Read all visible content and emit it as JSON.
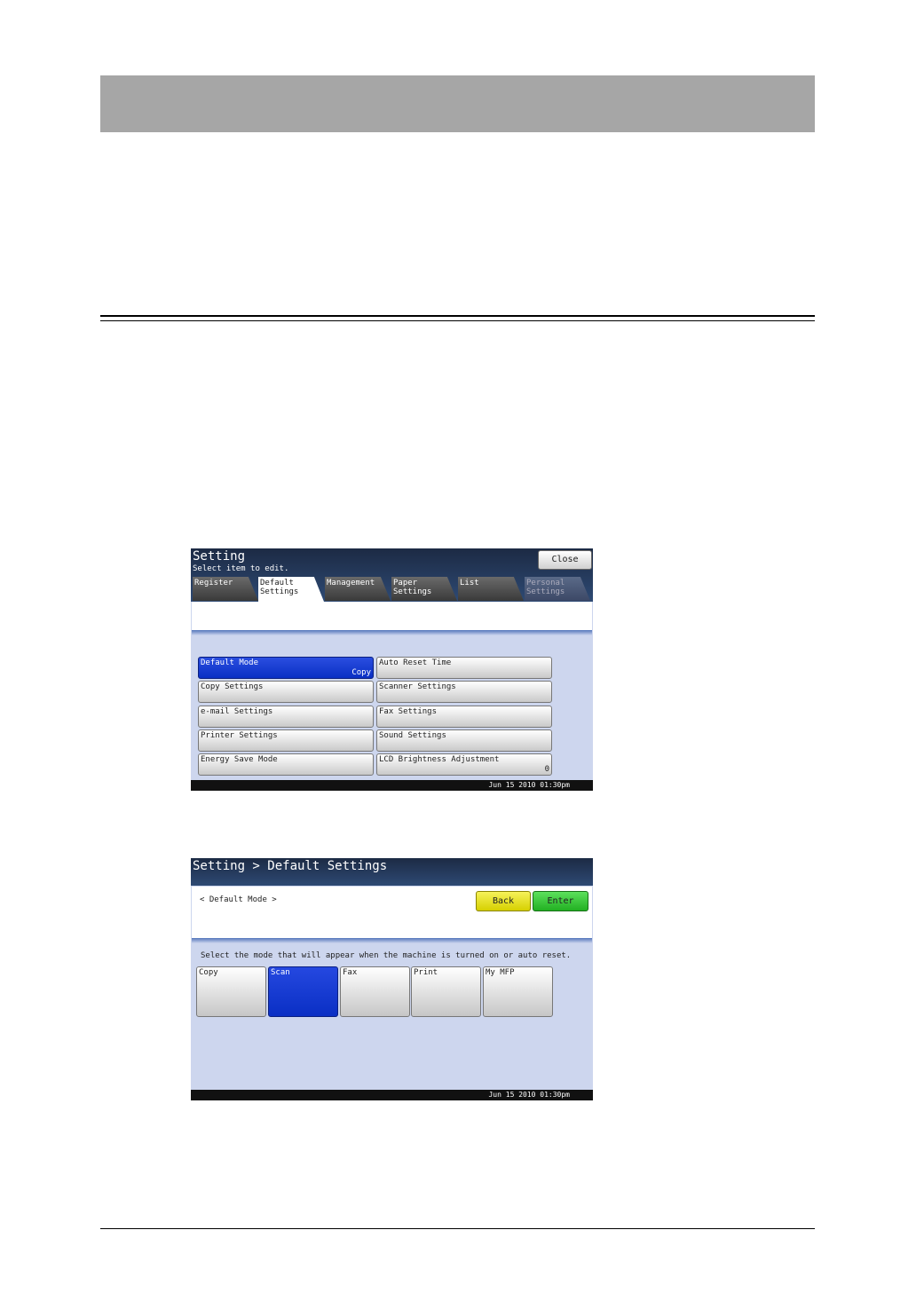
{
  "screen1": {
    "title": "Setting",
    "subtitle": "Select item to edit.",
    "close_label": "Close",
    "tabs": [
      {
        "label": "Register",
        "state": "normal"
      },
      {
        "label": "Default\nSettings",
        "state": "active"
      },
      {
        "label": "Management",
        "state": "normal"
      },
      {
        "label": "Paper\nSettings",
        "state": "normal"
      },
      {
        "label": "List",
        "state": "normal"
      },
      {
        "label": "Personal\nSettings",
        "state": "disabled"
      }
    ],
    "menu": [
      {
        "label": "Default Mode",
        "value": "Copy",
        "selected": true
      },
      {
        "label": "Auto Reset Time",
        "value": ""
      },
      {
        "label": "Copy Settings",
        "value": ""
      },
      {
        "label": "Scanner Settings",
        "value": ""
      },
      {
        "label": "e-mail Settings",
        "value": ""
      },
      {
        "label": "Fax Settings",
        "value": ""
      },
      {
        "label": "Printer Settings",
        "value": ""
      },
      {
        "label": "Sound Settings",
        "value": ""
      },
      {
        "label": "Energy Save Mode",
        "value": ""
      },
      {
        "label": "LCD Brightness Adjustment",
        "value": "0"
      }
    ],
    "datetime": "Jun 15 2010 01:30pm"
  },
  "screen2": {
    "title": "Setting > Default Settings",
    "section_label": "< Default Mode >",
    "back_label": "Back",
    "enter_label": "Enter",
    "instruction": "Select the mode that will appear when the machine is turned on or auto reset.",
    "modes": [
      {
        "label": "Copy",
        "selected": false
      },
      {
        "label": "Scan",
        "selected": true
      },
      {
        "label": "Fax",
        "selected": false
      },
      {
        "label": "Print",
        "selected": false
      },
      {
        "label": "My MFP",
        "selected": false
      }
    ],
    "datetime": "Jun 15 2010 01:30pm"
  },
  "colors": {
    "header_gray": "#a6a6a6",
    "selected_blue": "#0a2fc4",
    "screen_bg": "#cdd6ee",
    "back_yellow": "#e6e21a",
    "enter_green": "#2fc02f"
  }
}
